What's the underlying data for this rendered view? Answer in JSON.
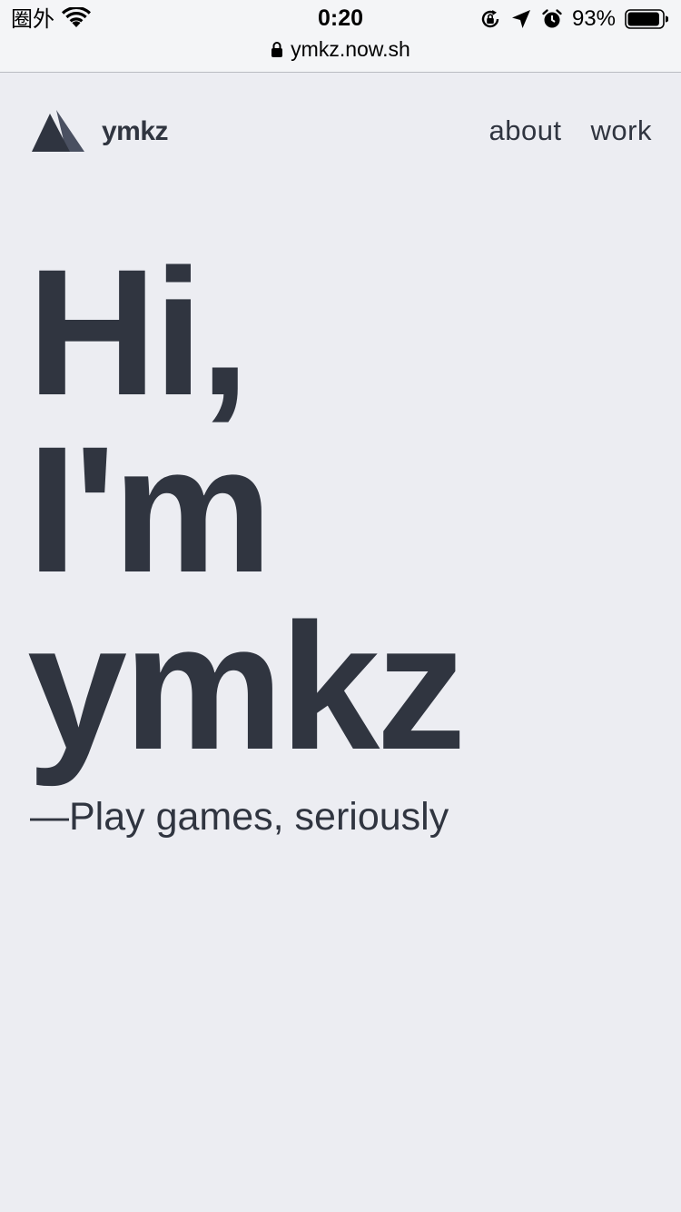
{
  "status_bar": {
    "carrier": "圈外",
    "time": "0:20",
    "battery_percent": "93%",
    "battery_level": 0.93,
    "icons": [
      "wifi-icon",
      "rotation-lock-icon",
      "location-arrow-icon",
      "alarm-icon",
      "battery-icon"
    ]
  },
  "browser": {
    "url": "ymkz.now.sh",
    "secure_icon": "lock-icon"
  },
  "header": {
    "logo_text": "ymkz",
    "nav": [
      {
        "label": "about"
      },
      {
        "label": "work"
      }
    ]
  },
  "hero": {
    "lines": [
      "Hi,",
      "I'm",
      "ymkz"
    ],
    "tagline": "—Play games, seriously"
  },
  "colors": {
    "background": "#ECEDF2",
    "text": "#303540",
    "status_bar_bg": "#F4F5F7",
    "logo_front": "#2F3440",
    "logo_back": "#4A5061"
  }
}
